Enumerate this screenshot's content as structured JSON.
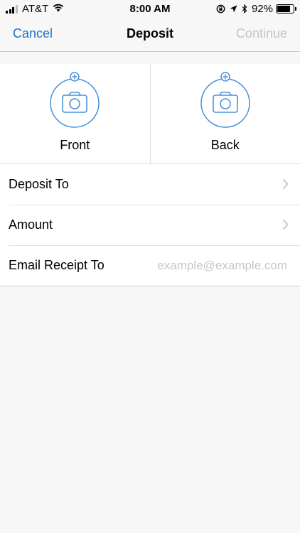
{
  "status_bar": {
    "carrier": "AT&T",
    "time": "8:00 AM",
    "battery": "92%",
    "battery_level": 0.92,
    "icons": [
      "signal-bars-icon",
      "wifi-icon",
      "orientation-lock-icon",
      "location-arrow-icon",
      "bluetooth-icon",
      "battery-icon"
    ]
  },
  "nav": {
    "cancel": "Cancel",
    "title": "Deposit",
    "continue": "Continue"
  },
  "photos": {
    "front_label": "Front",
    "back_label": "Back",
    "icon": "camera-add-icon"
  },
  "rows": {
    "deposit_to": "Deposit To",
    "amount": "Amount",
    "email_label": "Email Receipt To",
    "email_placeholder": "example@example.com",
    "email_value": ""
  },
  "colors": {
    "accent": "#1a73c9",
    "disabled": "#c4c4c6",
    "icon_blue": "#4a90d9",
    "background": "#f7f7f7"
  }
}
